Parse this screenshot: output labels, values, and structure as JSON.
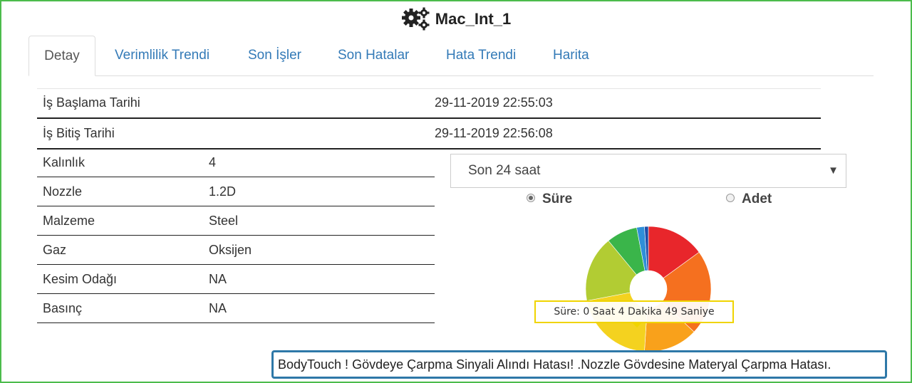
{
  "header": {
    "title": "Mac_Int_1",
    "icon": "gears-icon"
  },
  "tabs": [
    {
      "label": "Detay",
      "active": true
    },
    {
      "label": "Verimlilik Trendi"
    },
    {
      "label": "Son İşler"
    },
    {
      "label": "Son Hatalar"
    },
    {
      "label": "Hata Trendi"
    },
    {
      "label": "Harita"
    }
  ],
  "job_times": [
    {
      "label": "İş Başlama Tarihi",
      "value": "29-11-2019 22:55:03"
    },
    {
      "label": "İş Bitiş Tarihi",
      "value": "29-11-2019 22:56:08"
    }
  ],
  "params": [
    {
      "label": "Kalınlık",
      "value": "4"
    },
    {
      "label": "Nozzle",
      "value": "1.2D"
    },
    {
      "label": "Malzeme",
      "value": "Steel"
    },
    {
      "label": "Gaz",
      "value": "Oksijen"
    },
    {
      "label": "Kesim Odağı",
      "value": "NA"
    },
    {
      "label": "Basınç",
      "value": "NA"
    }
  ],
  "period_select": {
    "selected": "Son 24 saat"
  },
  "radios": [
    {
      "label": "Süre",
      "checked": true
    },
    {
      "label": "Adet",
      "checked": false
    }
  ],
  "chart_data": {
    "type": "pie",
    "donut": true,
    "slices": [
      {
        "color": "#e8262b",
        "value": 15
      },
      {
        "color": "#f5701f",
        "value": 22
      },
      {
        "color": "#f9a11b",
        "value": 14
      },
      {
        "color": "#f4d21f",
        "value": 21
      },
      {
        "color": "#b2cc33",
        "value": 17
      },
      {
        "color": "#3ab54a",
        "value": 8
      },
      {
        "color": "#2f8fd8",
        "value": 2
      },
      {
        "color": "#1f4ea8",
        "value": 1
      }
    ],
    "tooltip": "Süre: 0 Saat 4 Dakika 49 Saniye"
  },
  "alert": {
    "text": "BodyTouch ! Gövdeye Çarpma Sinyali Alındı Hatası! .Nozzle Gövdesine Materyal Çarpma Hatası."
  }
}
